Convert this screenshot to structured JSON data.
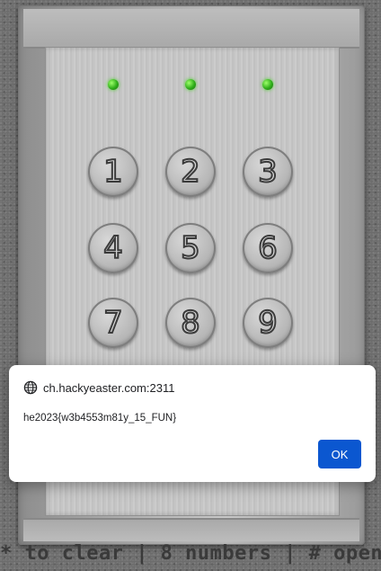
{
  "keypad": {
    "leds": [
      "green",
      "green",
      "green"
    ],
    "keys": [
      "1",
      "2",
      "3",
      "4",
      "5",
      "6",
      "7",
      "8",
      "9"
    ],
    "instructions": "* to clear | 8 numbers | # open"
  },
  "dialog": {
    "origin": "ch.hackyeaster.com:2311",
    "message": "he2023{w3b4553m81y_15_FUN}",
    "ok_label": "OK"
  },
  "colors": {
    "led_green": "#3cc324",
    "button_blue": "#0b57d0"
  }
}
